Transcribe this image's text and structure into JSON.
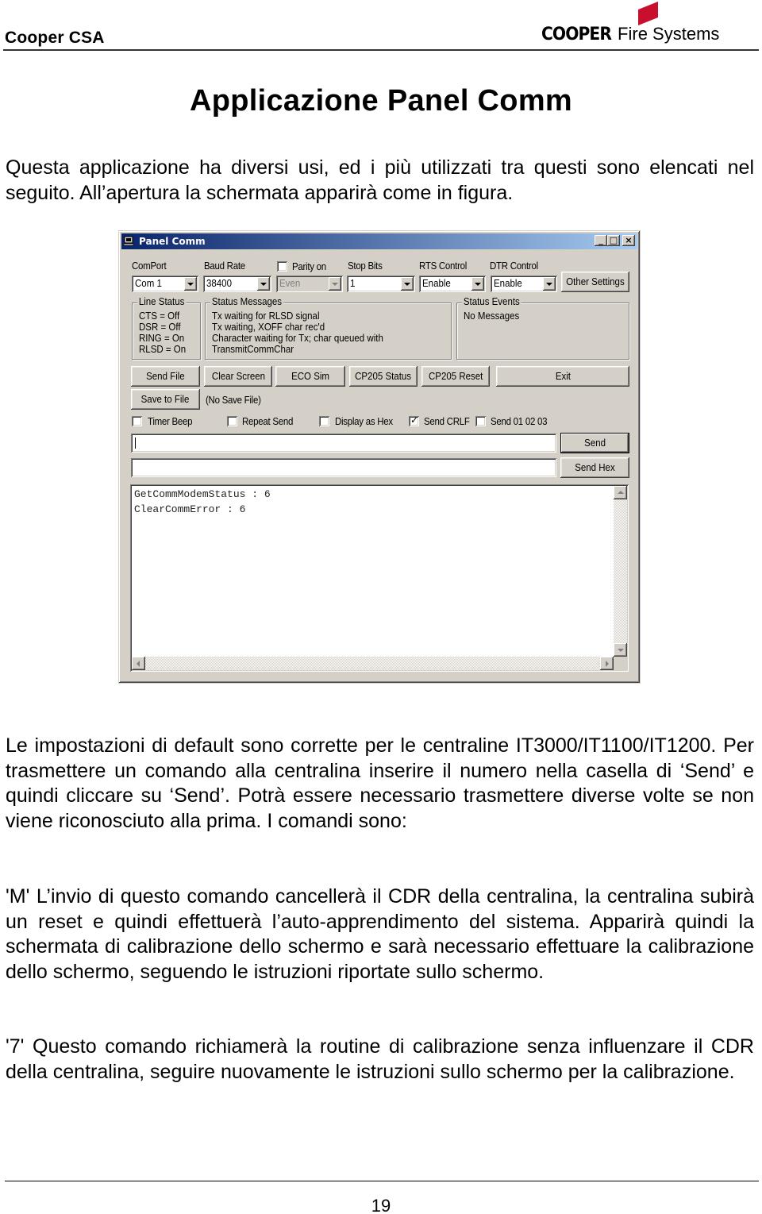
{
  "header": {
    "left_text": "Cooper CSA",
    "logo": {
      "brand": "COOPER",
      "suffix": "Fire Systems",
      "brand_color": "#c8102e"
    }
  },
  "document": {
    "title": "Applicazione Panel Comm",
    "paragraphs": [
      "Questa applicazione ha diversi usi, ed i più utilizzati tra questi sono elencati nel seguito. All’apertura la schermata apparirà come in figura.",
      "Le impostazioni di default sono corrette per le centraline IT3000/IT1100/IT1200. Per trasmettere un comando alla centralina inserire il numero nella casella di ‘Send’ e quindi cliccare su ‘Send’. Potrà essere necessario trasmettere diverse volte se non viene riconosciuto alla prima. I comandi sono:",
      "'M' L’invio di questo comando cancellerà il CDR della centralina, la centralina subirà un reset e quindi effettuerà l’auto-apprendimento del sistema. Apparirà quindi la schermata di calibrazione dello schermo e sarà necessario effettuare la calibrazione dello schermo, seguendo le istruzioni riportate sullo schermo.",
      "'7' Questo comando richiamerà la routine di calibrazione senza influenzare il CDR della centralina, seguire nuovamente le istruzioni sullo schermo per la calibrazione."
    ],
    "page_number": "19"
  },
  "window": {
    "title": "Panel Comm",
    "title_bar_color": "#0a246a",
    "controls": {
      "minimize": "_",
      "maximize": "□",
      "close": "×"
    },
    "settings": {
      "comport": {
        "label": "ComPort",
        "value": "Com 1"
      },
      "baud_rate": {
        "label": "Baud Rate",
        "value": "38400"
      },
      "parity": {
        "label": "Parity on",
        "checked": false,
        "value": "Even",
        "disabled": true
      },
      "stop_bits": {
        "label": "Stop Bits",
        "value": "1"
      },
      "rts_control": {
        "label": "RTS Control",
        "value": "Enable"
      },
      "dtr_control": {
        "label": "DTR Control",
        "value": "Enable"
      },
      "other_settings_label": "Other Settings"
    },
    "line_status": {
      "title": "Line Status",
      "lines": [
        "CTS = Off",
        "DSR = Off",
        "RING = On",
        "RLSD = On"
      ]
    },
    "status_messages": {
      "title": "Status Messages",
      "lines": [
        "Tx waiting for RLSD signal",
        "Tx waiting, XOFF char rec'd",
        "Character waiting for Tx; char queued with",
        "TransmitCommChar"
      ]
    },
    "status_events": {
      "title": "Status Events",
      "lines": [
        "No Messages"
      ]
    },
    "buttons": {
      "send_file": "Send File",
      "clear_screen": "Clear Screen",
      "eco_sim": "ECO Sim",
      "cp205_status": "CP205 Status",
      "cp205_reset": "CP205 Reset",
      "exit": "Exit",
      "save_to_file": "Save to File",
      "send": "Send",
      "send_hex": "Send Hex"
    },
    "save_file_status": "(No Save File)",
    "options": [
      {
        "label": "Timer Beep",
        "checked": false
      },
      {
        "label": "Repeat Send",
        "checked": false
      },
      {
        "label": "Display as Hex",
        "checked": false
      },
      {
        "label": "Send CRLF",
        "checked": true
      },
      {
        "label": "Send  01 02 03",
        "checked": false
      }
    ],
    "send_input": {
      "value": ""
    },
    "send_hex_input": {
      "value": ""
    },
    "output_lines": [
      "GetCommModemStatus : 6",
      "ClearCommError : 6"
    ]
  }
}
